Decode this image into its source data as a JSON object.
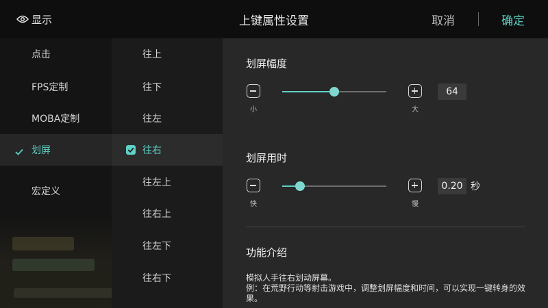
{
  "header": {
    "show_label": "显示",
    "title": "上键属性设置",
    "cancel_label": "取消",
    "confirm_label": "确定"
  },
  "categories": [
    {
      "label": "点击",
      "active": false
    },
    {
      "label": "FPS定制",
      "active": false
    },
    {
      "label": "MOBA定制",
      "active": false
    },
    {
      "label": "划屏",
      "active": true
    },
    {
      "label": "宏定义",
      "active": false
    }
  ],
  "directions": [
    {
      "label": "往上",
      "active": false
    },
    {
      "label": "往下",
      "active": false
    },
    {
      "label": "往左",
      "active": false
    },
    {
      "label": "往右",
      "active": true
    },
    {
      "label": "往左上",
      "active": false
    },
    {
      "label": "往右上",
      "active": false
    },
    {
      "label": "往左下",
      "active": false
    },
    {
      "label": "往右下",
      "active": false
    }
  ],
  "amplitude": {
    "title": "划屏幅度",
    "min_caption": "小",
    "max_caption": "大",
    "value": "64",
    "level": 0.5
  },
  "duration": {
    "title": "划屏用时",
    "min_caption": "快",
    "max_caption": "慢",
    "value": "0.20",
    "unit": "秒",
    "level": 0.17
  },
  "intro": {
    "title": "功能介绍",
    "line1": "模拟人手往右划动屏幕。",
    "line2": "例：在荒野行动等射击游戏中，调整划屏幅度和时间，可以实现一键转身的效果。"
  },
  "colors": {
    "accent": "#5fd1c6",
    "header_bg": "#0e0e0e",
    "panel_bg": "#282828"
  }
}
